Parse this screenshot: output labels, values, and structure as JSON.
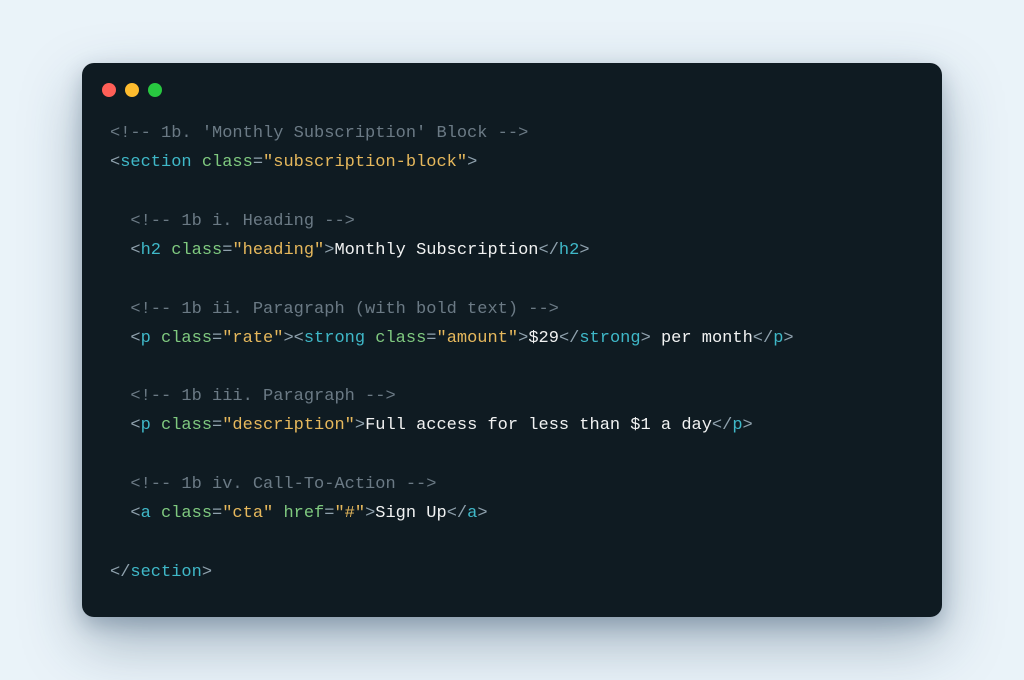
{
  "colors": {
    "page_bg": "#eaf3f9",
    "window_bg": "#0f1b22",
    "traffic_red": "#ff5f57",
    "traffic_yellow": "#febc2e",
    "traffic_green": "#28c840",
    "tok_comment": "#6b7a85",
    "tok_tag": "#3fb8c8",
    "tok_attr": "#7fc97f",
    "tok_string": "#e6b85c",
    "tok_text": "#f1f2f2",
    "tok_punct": "#8fa1ad"
  },
  "code": {
    "lines": [
      [
        {
          "t": "comment",
          "v": "<!-- 1b. 'Monthly Subscription' Block -->"
        }
      ],
      [
        {
          "t": "punct",
          "v": "<"
        },
        {
          "t": "tag",
          "v": "section"
        },
        {
          "t": "text",
          "v": " "
        },
        {
          "t": "attr",
          "v": "class"
        },
        {
          "t": "op",
          "v": "="
        },
        {
          "t": "string",
          "v": "\"subscription-block\""
        },
        {
          "t": "punct",
          "v": ">"
        }
      ],
      [],
      [
        {
          "t": "indent",
          "v": "  "
        },
        {
          "t": "comment",
          "v": "<!-- 1b i. Heading -->"
        }
      ],
      [
        {
          "t": "indent",
          "v": "  "
        },
        {
          "t": "punct",
          "v": "<"
        },
        {
          "t": "tag",
          "v": "h2"
        },
        {
          "t": "text",
          "v": " "
        },
        {
          "t": "attr",
          "v": "class"
        },
        {
          "t": "op",
          "v": "="
        },
        {
          "t": "string",
          "v": "\"heading\""
        },
        {
          "t": "punct",
          "v": ">"
        },
        {
          "t": "text",
          "v": "Monthly Subscription"
        },
        {
          "t": "punct",
          "v": "</"
        },
        {
          "t": "tag",
          "v": "h2"
        },
        {
          "t": "punct",
          "v": ">"
        }
      ],
      [],
      [
        {
          "t": "indent",
          "v": "  "
        },
        {
          "t": "comment",
          "v": "<!-- 1b ii. Paragraph (with bold text) -->"
        }
      ],
      [
        {
          "t": "indent",
          "v": "  "
        },
        {
          "t": "punct",
          "v": "<"
        },
        {
          "t": "tag",
          "v": "p"
        },
        {
          "t": "text",
          "v": " "
        },
        {
          "t": "attr",
          "v": "class"
        },
        {
          "t": "op",
          "v": "="
        },
        {
          "t": "string",
          "v": "\"rate\""
        },
        {
          "t": "punct",
          "v": ">"
        },
        {
          "t": "punct",
          "v": "<"
        },
        {
          "t": "tag",
          "v": "strong"
        },
        {
          "t": "text",
          "v": " "
        },
        {
          "t": "attr",
          "v": "class"
        },
        {
          "t": "op",
          "v": "="
        },
        {
          "t": "string",
          "v": "\"amount\""
        },
        {
          "t": "punct",
          "v": ">"
        },
        {
          "t": "text",
          "v": "$29"
        },
        {
          "t": "punct",
          "v": "</"
        },
        {
          "t": "tag",
          "v": "strong"
        },
        {
          "t": "punct",
          "v": ">"
        },
        {
          "t": "text",
          "v": " per month"
        },
        {
          "t": "punct",
          "v": "</"
        },
        {
          "t": "tag",
          "v": "p"
        },
        {
          "t": "punct",
          "v": ">"
        }
      ],
      [],
      [
        {
          "t": "indent",
          "v": "  "
        },
        {
          "t": "comment",
          "v": "<!-- 1b iii. Paragraph -->"
        }
      ],
      [
        {
          "t": "indent",
          "v": "  "
        },
        {
          "t": "punct",
          "v": "<"
        },
        {
          "t": "tag",
          "v": "p"
        },
        {
          "t": "text",
          "v": " "
        },
        {
          "t": "attr",
          "v": "class"
        },
        {
          "t": "op",
          "v": "="
        },
        {
          "t": "string",
          "v": "\"description\""
        },
        {
          "t": "punct",
          "v": ">"
        },
        {
          "t": "text",
          "v": "Full access for less than $1 a day"
        },
        {
          "t": "punct",
          "v": "</"
        },
        {
          "t": "tag",
          "v": "p"
        },
        {
          "t": "punct",
          "v": ">"
        }
      ],
      [],
      [
        {
          "t": "indent",
          "v": "  "
        },
        {
          "t": "comment",
          "v": "<!-- 1b iv. Call-To-Action -->"
        }
      ],
      [
        {
          "t": "indent",
          "v": "  "
        },
        {
          "t": "punct",
          "v": "<"
        },
        {
          "t": "tag",
          "v": "a"
        },
        {
          "t": "text",
          "v": " "
        },
        {
          "t": "attr",
          "v": "class"
        },
        {
          "t": "op",
          "v": "="
        },
        {
          "t": "string",
          "v": "\"cta\""
        },
        {
          "t": "text",
          "v": " "
        },
        {
          "t": "attr",
          "v": "href"
        },
        {
          "t": "op",
          "v": "="
        },
        {
          "t": "string",
          "v": "\"#\""
        },
        {
          "t": "punct",
          "v": ">"
        },
        {
          "t": "text",
          "v": "Sign Up"
        },
        {
          "t": "punct",
          "v": "</"
        },
        {
          "t": "tag",
          "v": "a"
        },
        {
          "t": "punct",
          "v": ">"
        }
      ],
      [],
      [
        {
          "t": "punct",
          "v": "</"
        },
        {
          "t": "tag",
          "v": "section"
        },
        {
          "t": "punct",
          "v": ">"
        }
      ]
    ]
  }
}
